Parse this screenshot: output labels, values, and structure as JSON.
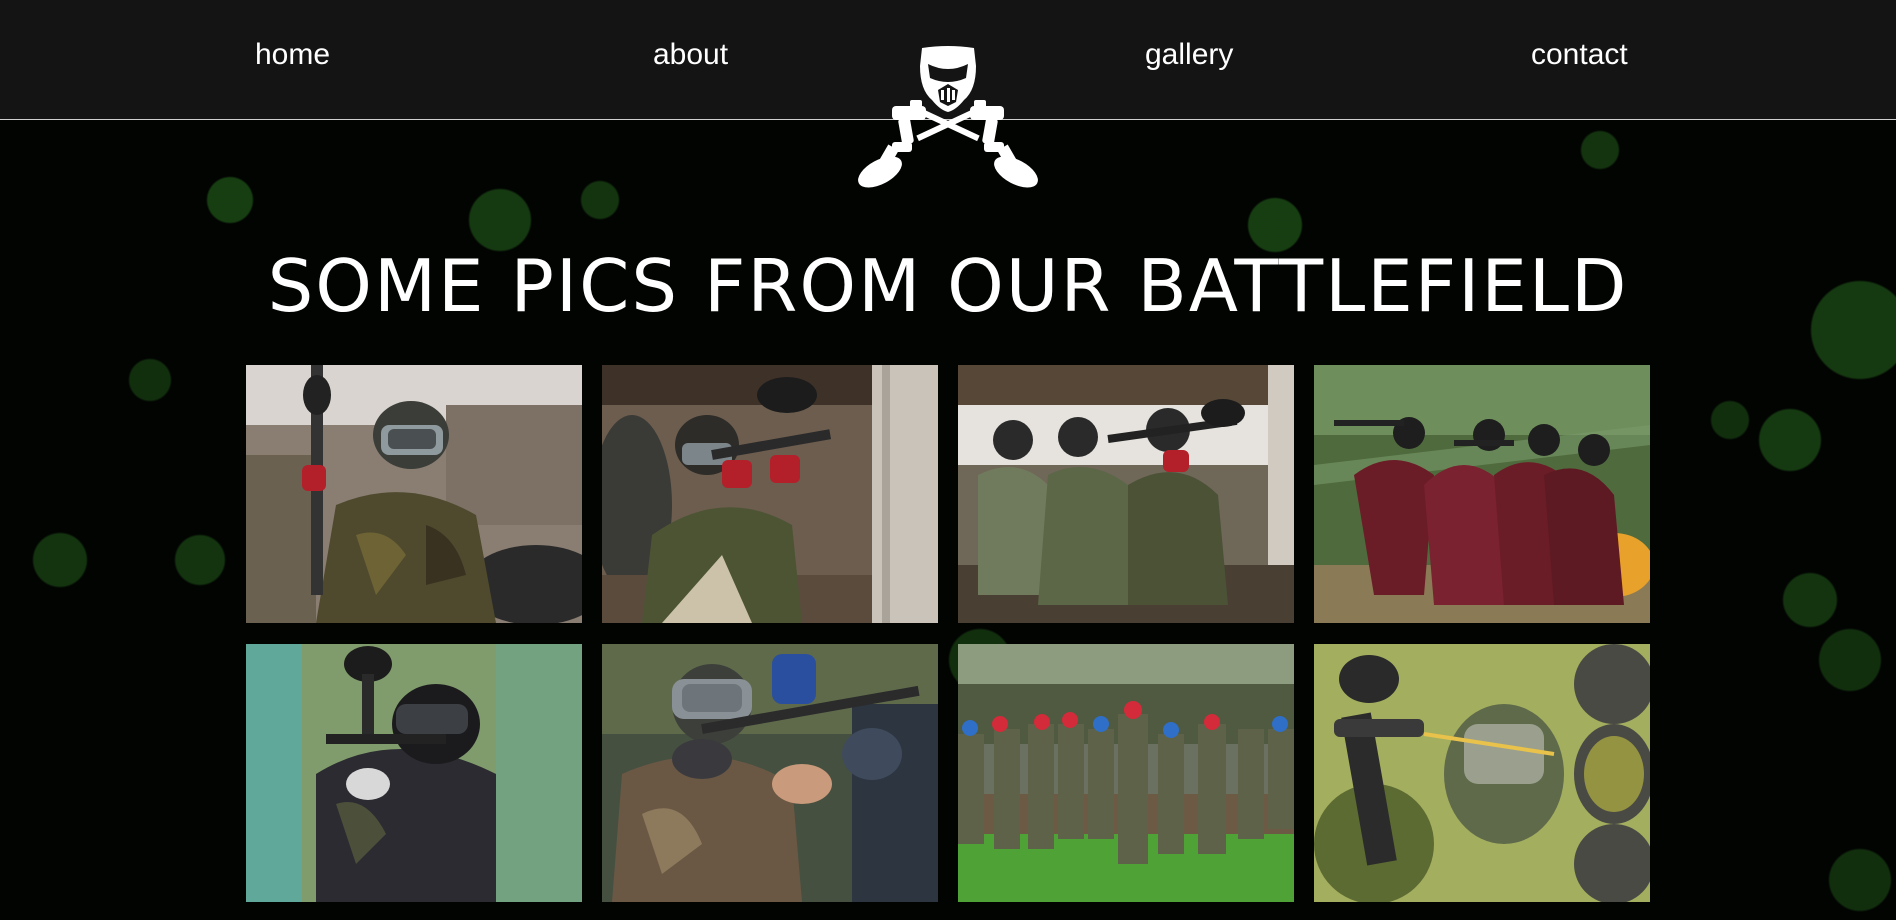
{
  "nav": {
    "home": "home",
    "about": "about",
    "gallery": "gallery",
    "contact": "contact",
    "logo_icon": "paintball-mask-crossed-markers-icon"
  },
  "heading": "SOME PICS FROM OUR BATTLEFIELD",
  "colors": {
    "nav_bg": "#141414",
    "page_bg": "#020402",
    "splatter": "#286e1e",
    "text": "#ffffff"
  },
  "gallery": {
    "photos": [
      {
        "name": "photo-player-with-marker-raised"
      },
      {
        "name": "photo-player-aiming-behind-post"
      },
      {
        "name": "photo-three-players-crouching"
      },
      {
        "name": "photo-red-team-advancing"
      },
      {
        "name": "photo-player-helmet-behind-cover"
      },
      {
        "name": "photo-player-aiming-closeup"
      },
      {
        "name": "photo-teams-on-field"
      },
      {
        "name": "photo-marker-firing-by-tires"
      }
    ]
  }
}
